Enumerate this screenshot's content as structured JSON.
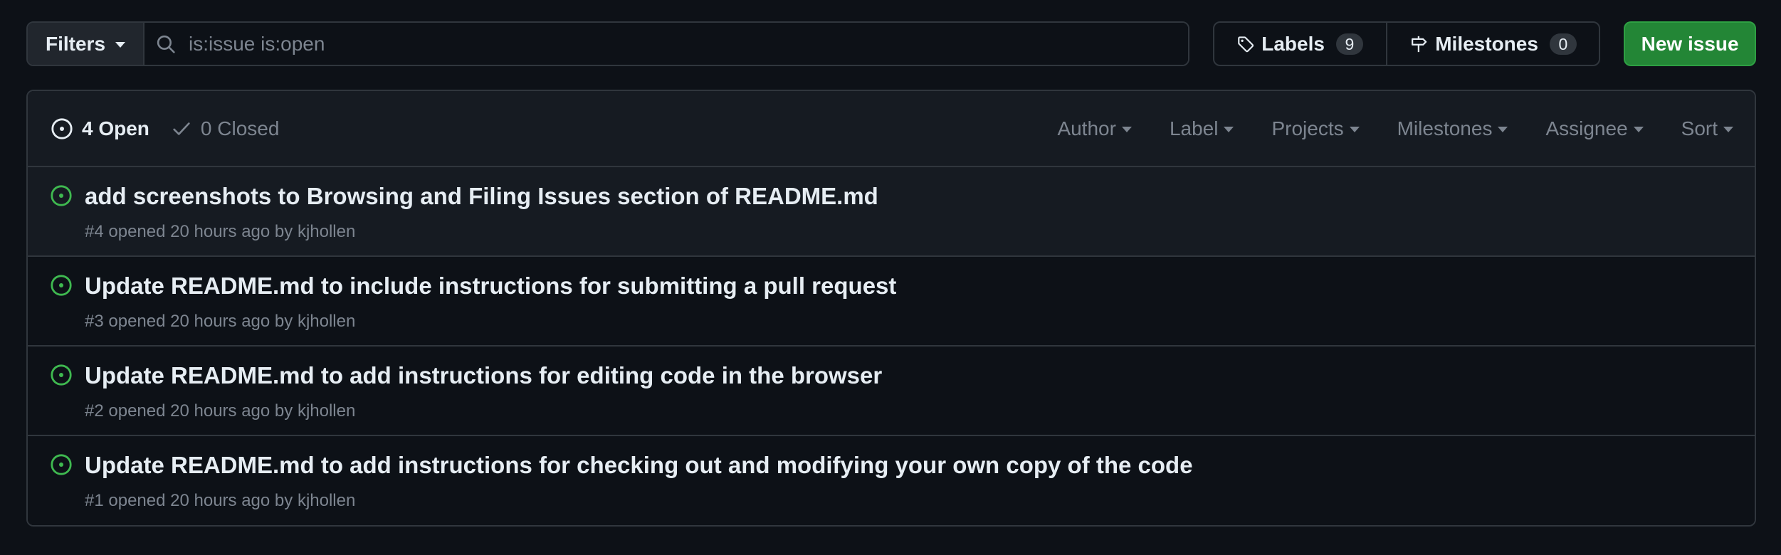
{
  "toolbar": {
    "filters_label": "Filters",
    "search_value": "is:issue is:open",
    "labels_label": "Labels",
    "labels_count": "9",
    "milestones_label": "Milestones",
    "milestones_count": "0",
    "new_issue_label": "New issue"
  },
  "header": {
    "open_label": "4 Open",
    "closed_label": "0 Closed",
    "dropdowns": [
      "Author",
      "Label",
      "Projects",
      "Milestones",
      "Assignee",
      "Sort"
    ]
  },
  "issues": [
    {
      "title": "add screenshots to Browsing and Filing Issues section of README.md",
      "number": "#4",
      "opened": "opened 20 hours ago by",
      "author": "kjhollen"
    },
    {
      "title": "Update README.md to include instructions for submitting a pull request",
      "number": "#3",
      "opened": "opened 20 hours ago by",
      "author": "kjhollen"
    },
    {
      "title": "Update README.md to add instructions for editing code in the browser",
      "number": "#2",
      "opened": "opened 20 hours ago by",
      "author": "kjhollen"
    },
    {
      "title": "Update README.md to add instructions for checking out and modifying your own copy of the code",
      "number": "#1",
      "opened": "opened 20 hours ago by",
      "author": "kjhollen"
    }
  ],
  "colors": {
    "background": "#0d1117",
    "border": "#30363d",
    "open_icon": "#3fb950",
    "primary_button": "#238636",
    "muted_text": "#7d8590"
  },
  "icons": {
    "filters_caret": "chevron-down-icon",
    "search": "search-icon",
    "labels": "tag-icon",
    "milestones": "milestone-icon",
    "open_state": "issue-opened-icon",
    "closed_state": "check-icon"
  }
}
